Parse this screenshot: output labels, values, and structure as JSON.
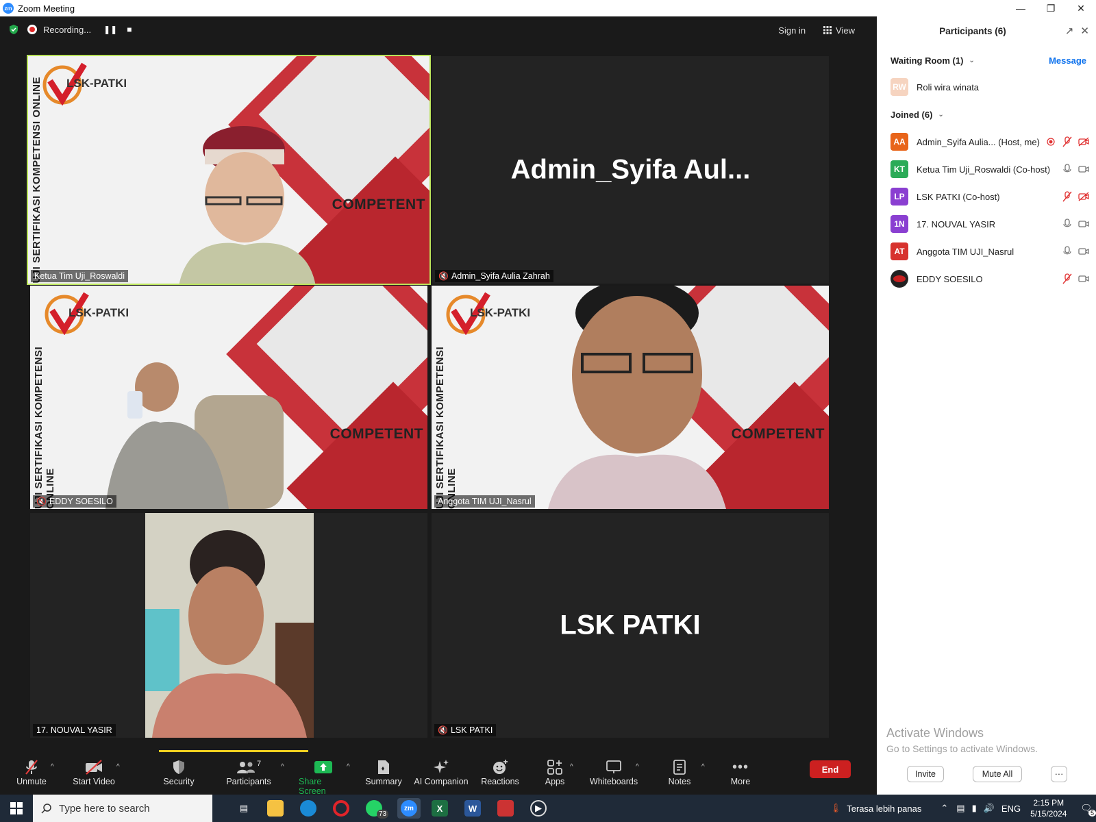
{
  "window": {
    "title": "Zoom Meeting"
  },
  "topbar": {
    "recording_label": "Recording...",
    "sign_in": "Sign in",
    "view": "View"
  },
  "tiles": {
    "t1": {
      "name": "Ketua Tim Uji_Roswaldi"
    },
    "t2": {
      "name": "Admin_Syifa Aulia Zahrah",
      "big": "Admin_Syifa  Aul..."
    },
    "t3": {
      "name": "EDDY SOESILO"
    },
    "t4": {
      "name": "Anggota TIM UJI_Nasrul"
    },
    "t5": {
      "name": "17. NOUVAL YASIR"
    },
    "t6": {
      "name": "LSK PATKI",
      "big": "LSK PATKI"
    }
  },
  "background_art": {
    "logo_text": "LSK-PATKI",
    "vertical_text": "UJI SERTIFIKASI KOMPETENSI ONLINE",
    "tagline": "COMPETENT"
  },
  "toolbar": {
    "unmute": "Unmute",
    "start_video": "Start Video",
    "security": "Security",
    "participants": "Participants",
    "participants_count": "7",
    "share_screen": "Share Screen",
    "summary": "Summary",
    "ai_companion": "AI Companion",
    "reactions": "Reactions",
    "apps": "Apps",
    "whiteboards": "Whiteboards",
    "notes": "Notes",
    "more": "More",
    "end": "End"
  },
  "panel": {
    "title": "Participants (6)",
    "waiting_room": "Waiting Room (1)",
    "message": "Message",
    "waiting": [
      {
        "initials": "RW",
        "name": "Roli wira winata",
        "color": "#f6c9b0"
      }
    ],
    "joined_header": "Joined (6)",
    "joined": [
      {
        "initials": "AA",
        "name": "Admin_Syifa Aulia... (Host, me)",
        "color": "#e8651a"
      },
      {
        "initials": "KT",
        "name": "Ketua Tim Uji_Roswaldi (Co-host)",
        "color": "#2bab57"
      },
      {
        "initials": "LP",
        "name": "LSK PATKI (Co-host)",
        "color": "#8a3fd1"
      },
      {
        "initials": "1N",
        "name": "17. NOUVAL YASIR",
        "color": "#8a3fd1"
      },
      {
        "initials": "AT",
        "name": "Anggota TIM UJI_Nasrul",
        "color": "#d7322e"
      },
      {
        "initials": "",
        "name": "EDDY SOESILO",
        "color": "#2a2a2a"
      }
    ],
    "activate_title": "Activate Windows",
    "activate_sub": "Go to Settings to activate Windows.",
    "invite": "Invite",
    "mute_all": "Mute All",
    "more": "···"
  },
  "taskbar": {
    "search_placeholder": "Type here to search",
    "whatsapp_badge": "73",
    "zoom_icon": "zm",
    "weather": "Terasa lebih panas",
    "lang": "ENG",
    "time": "2:15 PM",
    "date": "5/15/2024",
    "notif_count": "5"
  }
}
